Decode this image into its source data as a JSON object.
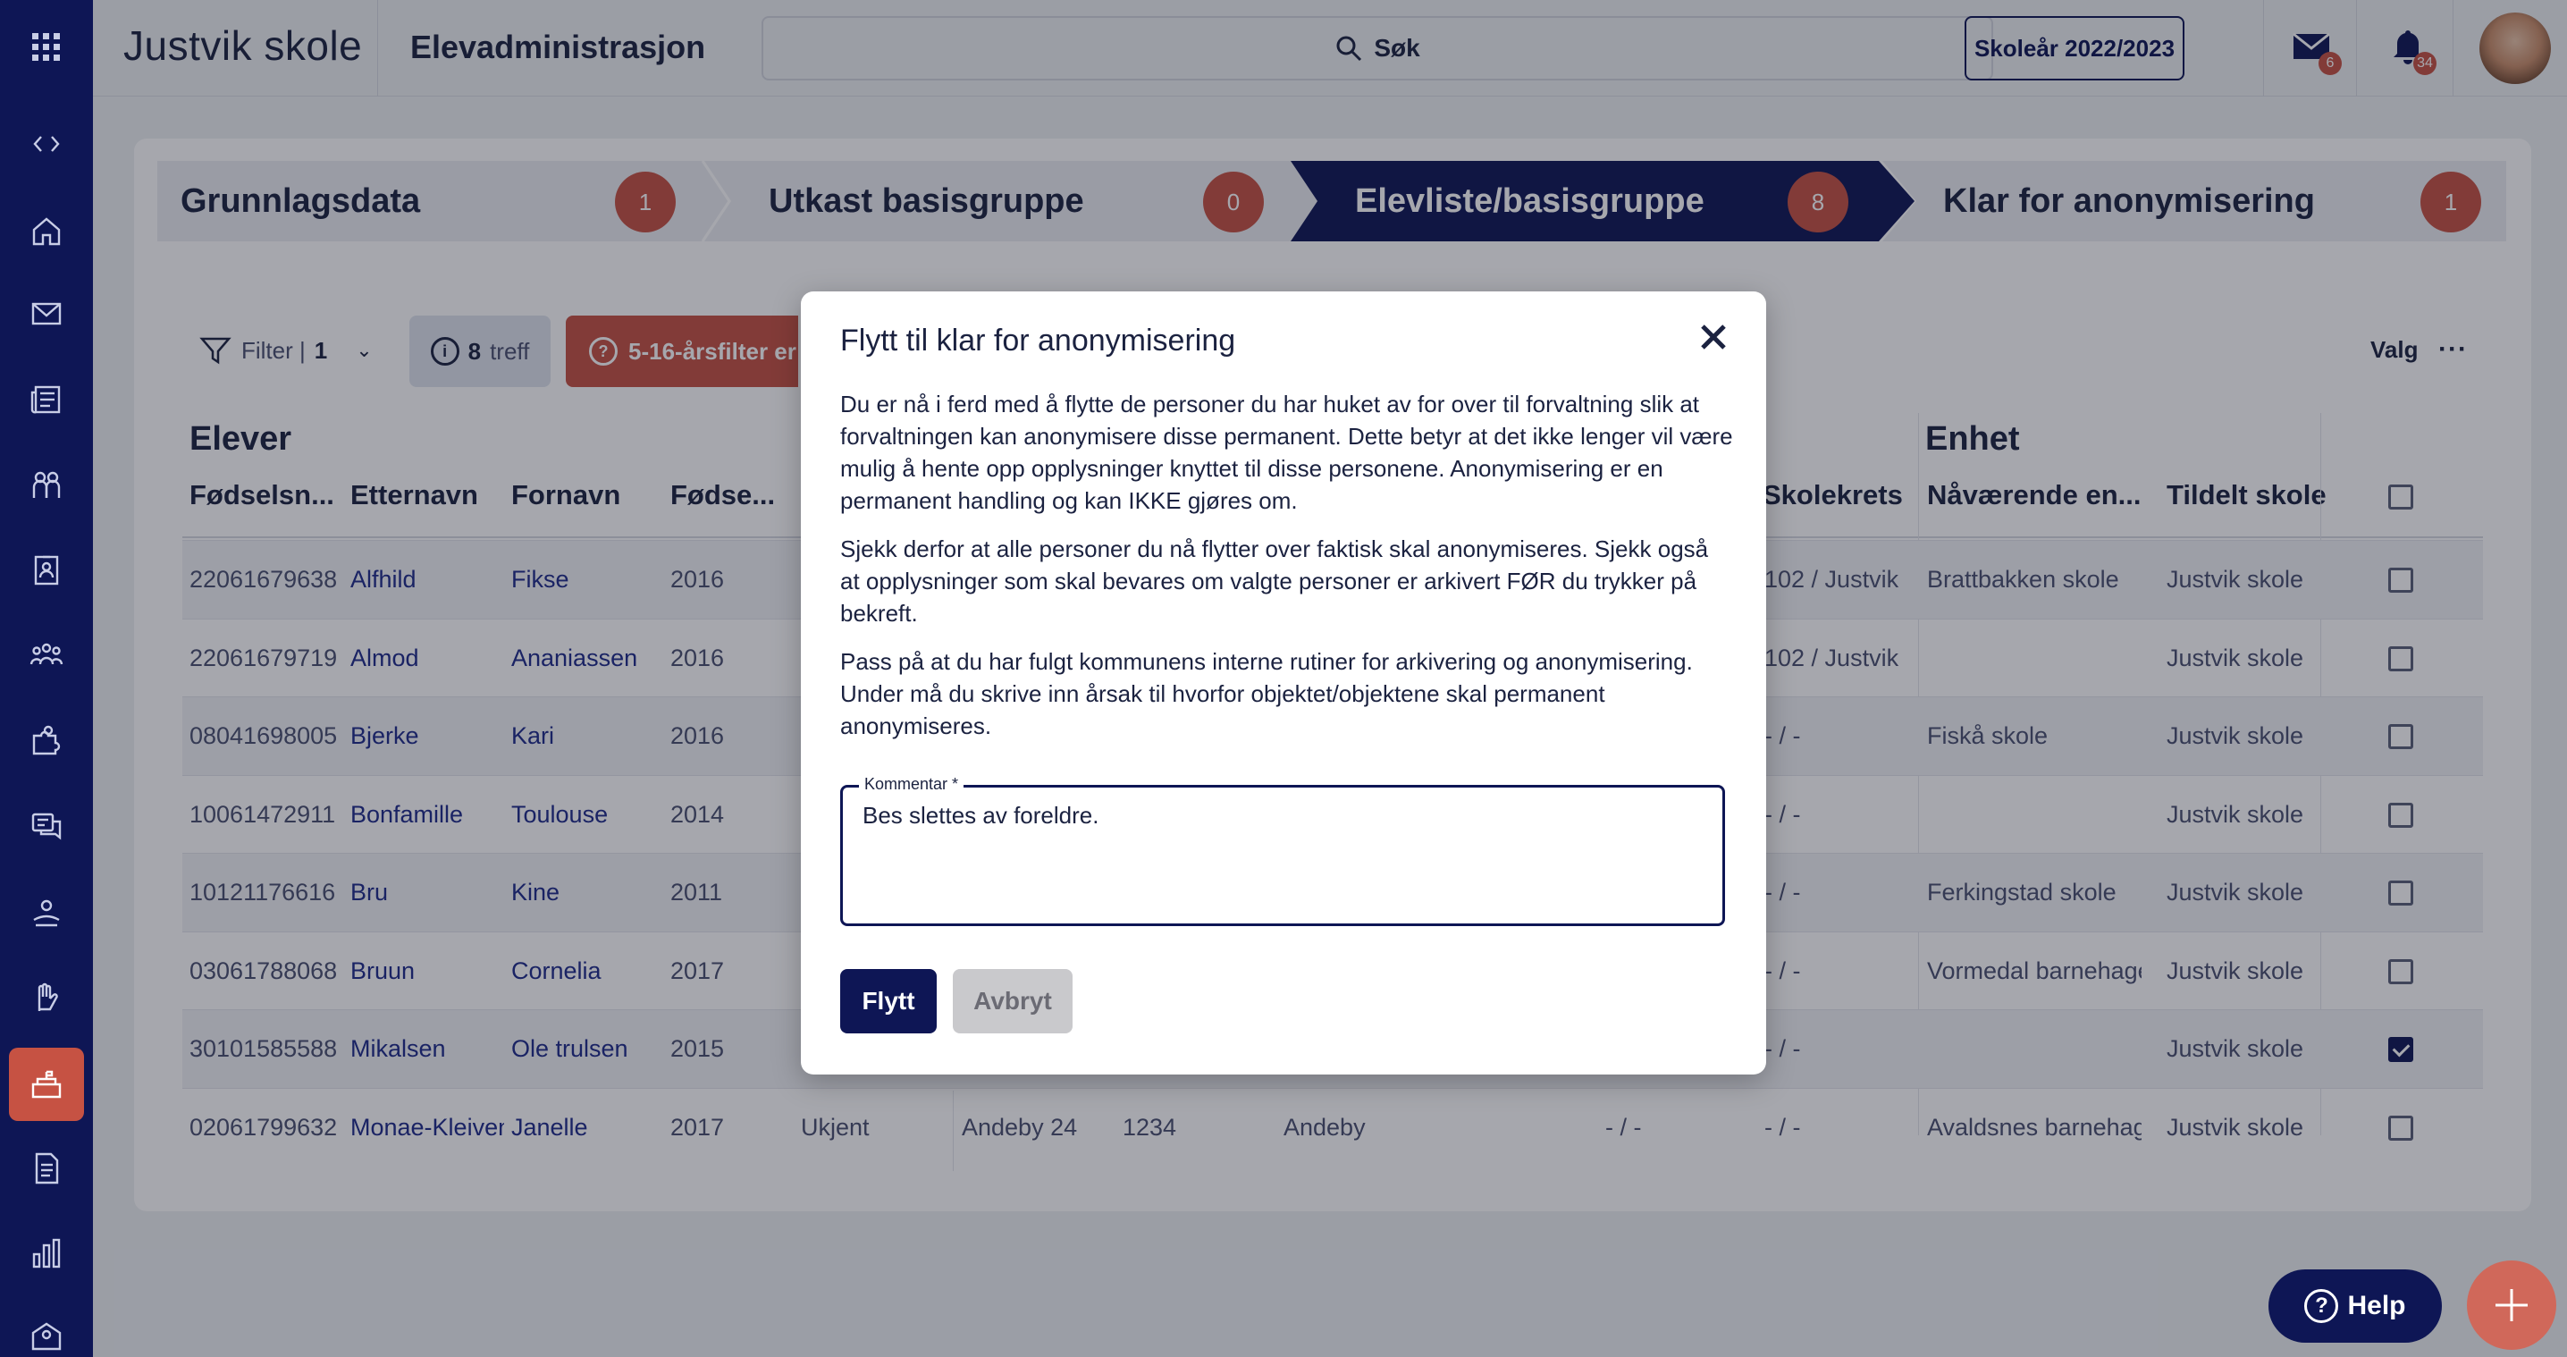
{
  "header": {
    "brand": "Justvik skole",
    "app_title": "Elevadministrasjon",
    "search_label": "Søk",
    "school_year": "Skoleår 2022/2023",
    "mail_count": "6",
    "notification_count": "34"
  },
  "sidebar": {
    "icons": [
      "grid-icon",
      "collapse-icon",
      "home-icon",
      "mail-icon",
      "news-icon",
      "people-icon",
      "badge-icon",
      "group-icon",
      "puzzle-icon",
      "chat-icon",
      "hand-icon",
      "raise-hand-icon",
      "school-icon",
      "document-icon",
      "chart-icon",
      "building-icon"
    ],
    "active": "school-icon"
  },
  "stepper": [
    {
      "label": "Grunnlagsdata",
      "count": "1",
      "active": false
    },
    {
      "label": "Utkast basisgruppe",
      "count": "0",
      "active": false
    },
    {
      "label": "Elevliste/basisgruppe",
      "count": "8",
      "active": true
    },
    {
      "label": "Klar for anonymisering",
      "count": "1",
      "active": false
    }
  ],
  "toolbar": {
    "filter_label": "Filter |",
    "filter_count": "1",
    "hits_count": "8",
    "hits_label": "treff",
    "warning_label": "5-16-årsfilter er",
    "valg_label": "Valg",
    "more_label": "···"
  },
  "table": {
    "group_elever": "Elever",
    "group_enhet": "Enhet",
    "headers": {
      "fodselsnr": "Fødselsn...",
      "etternavn": "Etternavn",
      "fornavn": "Fornavn",
      "fodselsar": "Fødse...",
      "skolekrets": "Skolekrets",
      "naavaerende": "Nåværende en...",
      "tildelt": "Tildelt skole"
    },
    "rows": [
      {
        "fnr": "22061679638",
        "etternavn": "Alfhild",
        "fornavn": "Fikse",
        "ar": "2016",
        "kjonn": "",
        "adresse": "",
        "postnr": "",
        "poststed": "",
        "col9": "",
        "krets": "102 / Justvik",
        "enhet": "Brattbakken skole",
        "tildelt": "Justvik skole",
        "checked": false
      },
      {
        "fnr": "22061679719",
        "etternavn": "Almod",
        "fornavn": "Ananiassen",
        "ar": "2016",
        "kjonn": "",
        "adresse": "",
        "postnr": "",
        "poststed": "",
        "col9": "",
        "krets": "102 / Justvik",
        "enhet": "",
        "tildelt": "Justvik skole",
        "checked": false
      },
      {
        "fnr": "08041698005",
        "etternavn": "Bjerke",
        "fornavn": "Kari",
        "ar": "2016",
        "kjonn": "",
        "adresse": "",
        "postnr": "",
        "poststed": "",
        "col9": "",
        "krets": "- / -",
        "enhet": "Fiskå skole",
        "tildelt": "Justvik skole",
        "checked": false
      },
      {
        "fnr": "10061472911",
        "etternavn": "Bonfamille",
        "fornavn": "Toulouse",
        "ar": "2014",
        "kjonn": "",
        "adresse": "",
        "postnr": "",
        "poststed": "",
        "col9": "",
        "krets": "- / -",
        "enhet": "",
        "tildelt": "Justvik skole",
        "checked": false
      },
      {
        "fnr": "10121176616",
        "etternavn": "Bru",
        "fornavn": "Kine",
        "ar": "2011",
        "kjonn": "",
        "adresse": "",
        "postnr": "",
        "poststed": "",
        "col9": "",
        "krets": "- / -",
        "enhet": "Ferkingstad skole",
        "tildelt": "Justvik skole",
        "checked": false
      },
      {
        "fnr": "03061788068",
        "etternavn": "Bruun",
        "fornavn": "Cornelia",
        "ar": "2017",
        "kjonn": "",
        "adresse": "",
        "postnr": "",
        "poststed": "",
        "col9": "",
        "krets": "- / -",
        "enhet": "Vormedal barnehage",
        "tildelt": "Justvik skole",
        "checked": false
      },
      {
        "fnr": "30101585588",
        "etternavn": "Mikalsen",
        "fornavn": "Ole trulsen",
        "ar": "2015",
        "kjonn": "",
        "adresse": "",
        "postnr": "",
        "poststed": "",
        "col9": "",
        "krets": "- / -",
        "enhet": "",
        "tildelt": "Justvik skole",
        "checked": true
      },
      {
        "fnr": "02061799632",
        "etternavn": "Monae-Kleiven",
        "fornavn": "Janelle",
        "ar": "2017",
        "kjonn": "Ukjent",
        "adresse": "Andeby 24",
        "postnr": "1234",
        "poststed": "Andeby",
        "col9": "- / -",
        "krets": "- / -",
        "enhet": "Avaldsnes barnehage",
        "tildelt": "Justvik skole",
        "checked": false
      }
    ]
  },
  "modal": {
    "title": "Flytt til klar for anonymisering",
    "paragraph1": "Du er nå i ferd med å flytte de personer du har huket av for over til forvaltning slik at forvaltningen kan anonymisere disse permanent. Dette betyr at det ikke lenger vil være mulig å hente opp opplysninger knyttet til disse personene. Anonymisering er en permanent handling og kan IKKE gjøres om.",
    "paragraph2": "Sjekk derfor at alle personer du nå flytter over faktisk skal anonymiseres. Sjekk også at opplysninger som skal bevares om valgte personer er arkivert FØR du trykker på bekreft.",
    "paragraph3": "Pass på at du har fulgt kommunens interne rutiner for arkivering og anonymisering. Under må du skrive inn årsak til hvorfor objektet/objektene skal permanent anonymiseres.",
    "comment_label": "Kommentar *",
    "comment_value": "Bes slettes av foreldre.",
    "confirm_label": "Flytt",
    "cancel_label": "Avbryt"
  },
  "floating": {
    "help_label": "Help"
  },
  "colors": {
    "navy": "#0e1655",
    "accent_red": "#c65243",
    "link_blue": "#1e2b8a"
  }
}
